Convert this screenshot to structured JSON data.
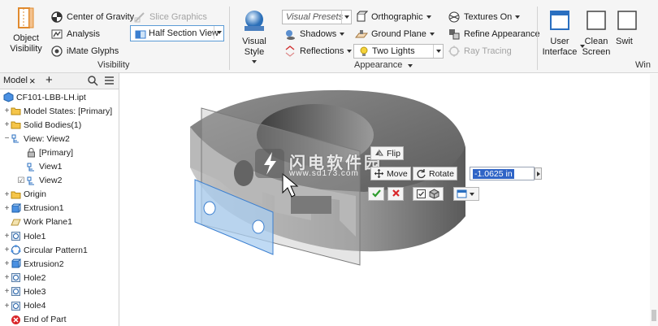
{
  "ribbon": {
    "visibility_panel": {
      "object_visibility": "Object\nVisibility",
      "center_of_gravity": "Center of Gravity",
      "analysis": "Analysis",
      "imate_glyphs": "iMate Glyphs",
      "slice_graphics": "Slice Graphics",
      "half_section_view": "Half Section View",
      "label": "Visibility"
    },
    "appearance_panel": {
      "visual_style": "Visual Style",
      "visual_presets": "Visual Presets",
      "shadows": "Shadows",
      "reflections": "Reflections",
      "orthographic": "Orthographic",
      "ground_plane": "Ground Plane",
      "two_lights": "Two Lights",
      "textures_on": "Textures On",
      "refine_appearance": "Refine Appearance",
      "ray_tracing": "Ray Tracing",
      "label": "Appearance"
    },
    "windows_panel": {
      "user_interface": "User\nInterface",
      "clean_screen": "Clean\nScreen",
      "switch": "Swit",
      "label": "Win"
    }
  },
  "browser": {
    "tab_label": "Model",
    "items": [
      {
        "label": "CF101-LBB-LH.ipt",
        "icon": "part-icon",
        "indent": 0
      },
      {
        "label": "Model States: [Primary]",
        "icon": "folder-icon",
        "indent": 1
      },
      {
        "label": "Solid Bodies(1)",
        "icon": "folder-icon",
        "indent": 1
      },
      {
        "label": "View: View2",
        "icon": "view-icon",
        "indent": 1
      },
      {
        "label": "[Primary]",
        "icon": "lock-icon",
        "indent": 2
      },
      {
        "label": "View1",
        "icon": "view-icon",
        "indent": 2
      },
      {
        "label": "View2",
        "icon": "view-icon",
        "indent": 2
      },
      {
        "label": "Origin",
        "icon": "folder-icon",
        "indent": 1
      },
      {
        "label": "Extrusion1",
        "icon": "extrusion-icon",
        "indent": 1
      },
      {
        "label": "Work Plane1",
        "icon": "workplane-icon",
        "indent": 1
      },
      {
        "label": "Hole1",
        "icon": "hole-icon",
        "indent": 1
      },
      {
        "label": "Circular Pattern1",
        "icon": "pattern-icon",
        "indent": 1
      },
      {
        "label": "Extrusion2",
        "icon": "extrusion-icon",
        "indent": 1
      },
      {
        "label": "Hole2",
        "icon": "hole-icon",
        "indent": 1
      },
      {
        "label": "Hole3",
        "icon": "hole-icon",
        "indent": 1
      },
      {
        "label": "Hole4",
        "icon": "hole-icon",
        "indent": 1
      },
      {
        "label": "End of Part",
        "icon": "end-of-part-icon",
        "indent": 1
      }
    ]
  },
  "minitoolbar": {
    "flip": "Flip",
    "move": "Move",
    "rotate": "Rotate",
    "offset_value": "-1.0625 in"
  },
  "watermark": {
    "text": "闪电软件园",
    "url": "www.sd173.com"
  },
  "colors": {
    "accent": "#2f64c6",
    "ok_green": "#2e9c2e",
    "cancel_red": "#d9262a",
    "plane_blue": "#a9cdf0"
  }
}
